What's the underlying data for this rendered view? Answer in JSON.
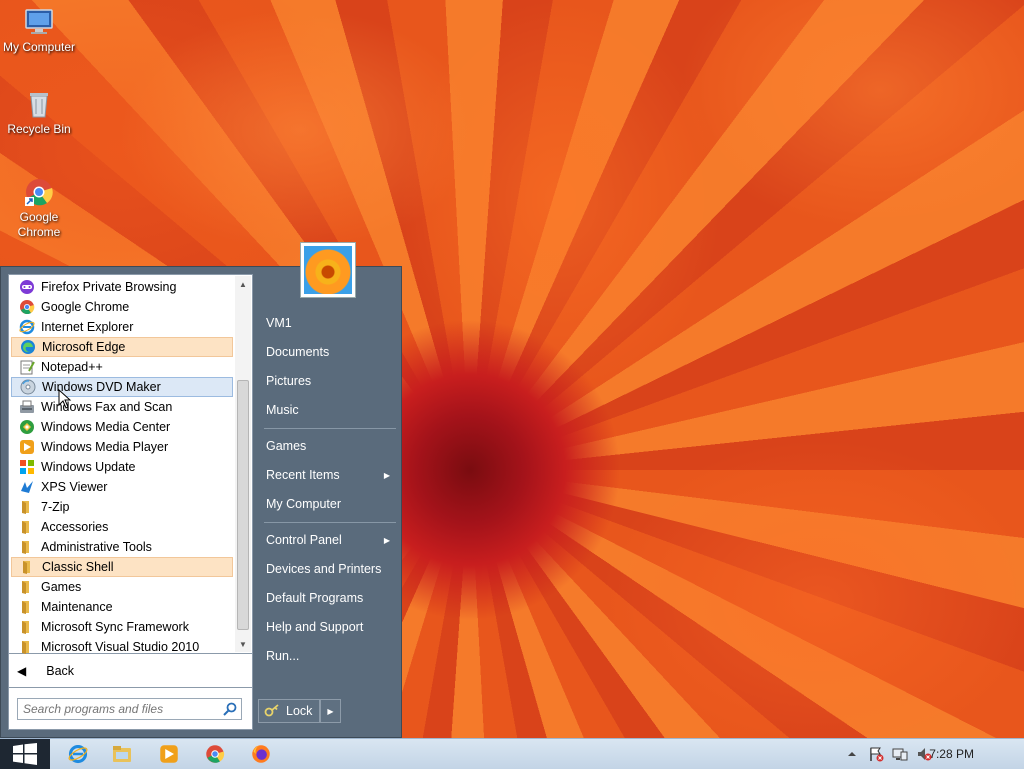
{
  "desktop": {
    "icons": [
      {
        "label": "My Computer",
        "icon": "computer-icon"
      },
      {
        "label": "Recycle Bin",
        "icon": "recycle-bin-icon"
      },
      {
        "label": "Google Chrome",
        "icon": "chrome-shortcut-icon"
      }
    ]
  },
  "start_menu": {
    "programs": [
      {
        "label": "Firefox Private Browsing",
        "icon": "firefox-private-icon",
        "highlight": ""
      },
      {
        "label": "Google Chrome",
        "icon": "chrome-icon",
        "highlight": ""
      },
      {
        "label": "Internet Explorer",
        "icon": "ie-icon",
        "highlight": ""
      },
      {
        "label": "Microsoft Edge",
        "icon": "edge-icon",
        "highlight": "orange"
      },
      {
        "label": "Notepad++",
        "icon": "notepad-plus-icon",
        "highlight": ""
      },
      {
        "label": "Windows DVD Maker",
        "icon": "dvd-maker-icon",
        "highlight": "blue"
      },
      {
        "label": "Windows Fax and Scan",
        "icon": "fax-icon",
        "highlight": ""
      },
      {
        "label": "Windows Media Center",
        "icon": "media-center-icon",
        "highlight": ""
      },
      {
        "label": "Windows Media Player",
        "icon": "media-player-icon",
        "highlight": ""
      },
      {
        "label": "Windows Update",
        "icon": "windows-update-icon",
        "highlight": ""
      },
      {
        "label": "XPS Viewer",
        "icon": "xps-viewer-icon",
        "highlight": ""
      },
      {
        "label": "7-Zip",
        "icon": "folder-icon",
        "highlight": ""
      },
      {
        "label": "Accessories",
        "icon": "folder-icon",
        "highlight": ""
      },
      {
        "label": "Administrative Tools",
        "icon": "folder-icon",
        "highlight": ""
      },
      {
        "label": "Classic Shell",
        "icon": "folder-icon",
        "highlight": "orange"
      },
      {
        "label": "Games",
        "icon": "folder-icon",
        "highlight": ""
      },
      {
        "label": "Maintenance",
        "icon": "folder-icon",
        "highlight": ""
      },
      {
        "label": "Microsoft Sync Framework",
        "icon": "folder-icon",
        "highlight": ""
      },
      {
        "label": "Microsoft Visual Studio 2010",
        "icon": "folder-icon",
        "highlight": ""
      }
    ],
    "back_label": "Back",
    "search_placeholder": "Search programs and files",
    "right_items": [
      {
        "label": "VM1",
        "submenu": false
      },
      {
        "label": "Documents",
        "submenu": false
      },
      {
        "label": "Pictures",
        "submenu": false
      },
      {
        "label": "Music",
        "submenu": false
      },
      {
        "label": "Games",
        "submenu": false
      },
      {
        "label": "Recent Items",
        "submenu": true
      },
      {
        "label": "My Computer",
        "submenu": false
      },
      {
        "label": "Control Panel",
        "submenu": true
      },
      {
        "label": "Devices and Printers",
        "submenu": false
      },
      {
        "label": "Default Programs",
        "submenu": false
      },
      {
        "label": "Help and Support",
        "submenu": false
      },
      {
        "label": "Run...",
        "submenu": false
      }
    ],
    "lock_label": "Lock"
  },
  "taskbar": {
    "pinned": [
      "ie-icon",
      "explorer-icon",
      "media-player-icon",
      "chrome-icon",
      "firefox-icon"
    ],
    "clock": "7:28 PM"
  },
  "colors": {
    "menu_bg": "#5a6b7c",
    "highlight_orange": "#fde3c4",
    "highlight_blue": "#dce8f6"
  }
}
